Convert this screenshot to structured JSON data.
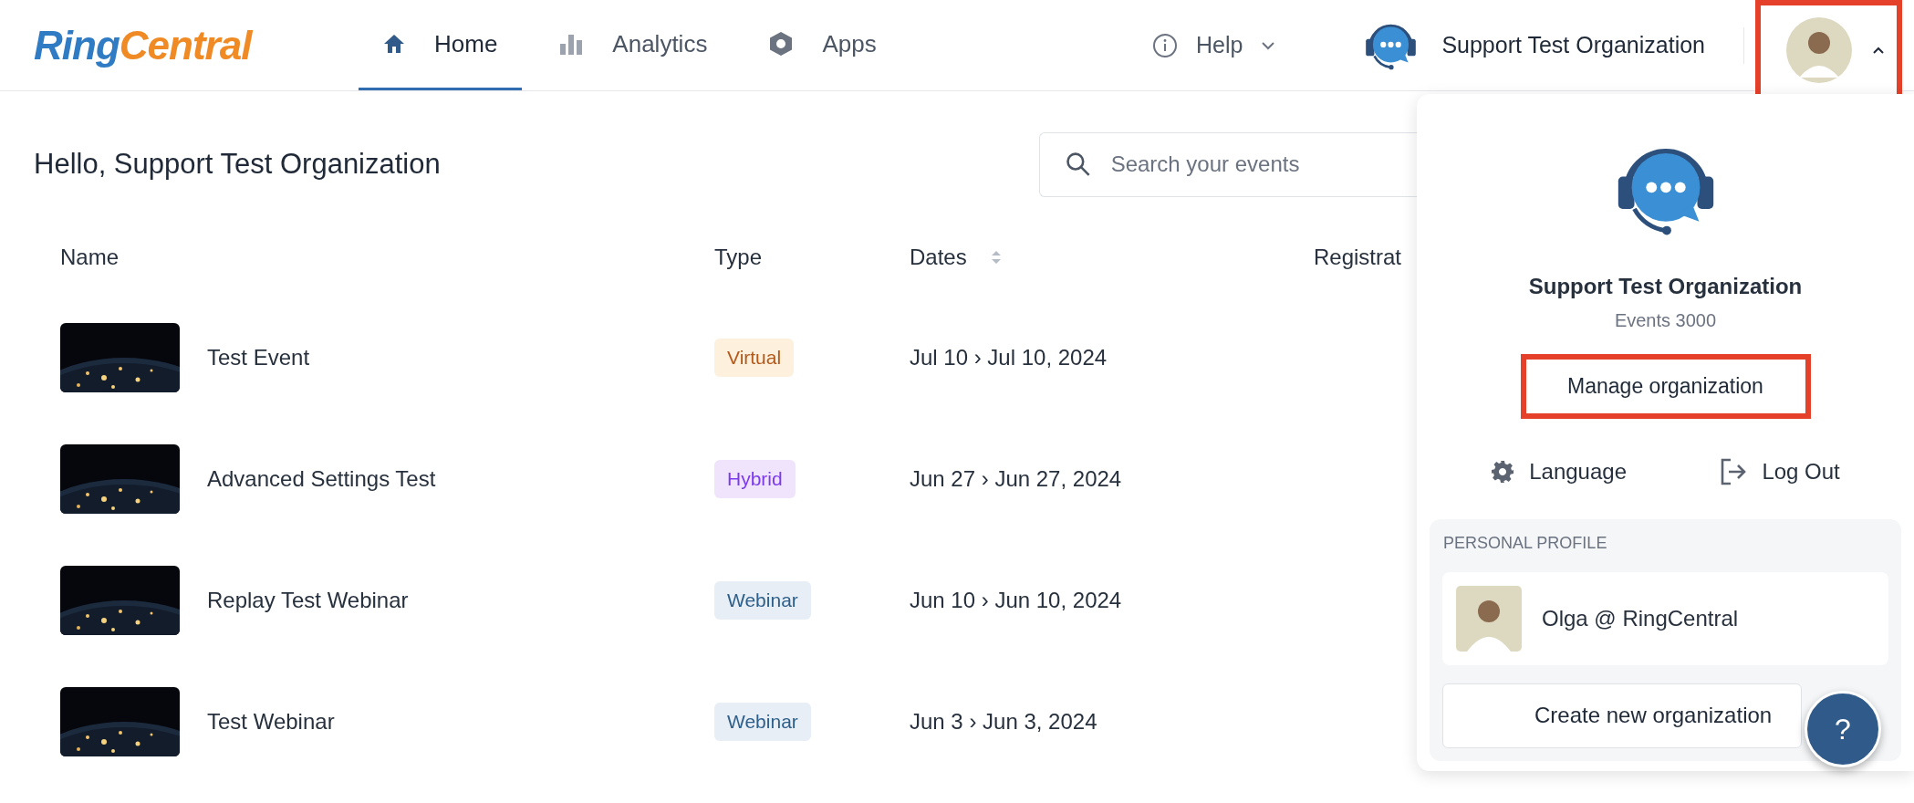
{
  "header": {
    "logo": {
      "part_1": "Ring",
      "part_2": "Central"
    },
    "nav": [
      {
        "label": "Home",
        "kind": "home",
        "selected": true
      },
      {
        "label": "Analytics",
        "kind": "analytics",
        "selected": false
      },
      {
        "label": "Apps",
        "kind": "apps",
        "selected": false
      }
    ],
    "help": "Help",
    "organization": "Support Test Organization",
    "account_menu": {
      "expanded": true,
      "highlighted": true
    }
  },
  "greeting": "Hello, Support Test Organization",
  "search": {
    "placeholder": "Search your events"
  },
  "table": {
    "columns": [
      {
        "label": "Name",
        "sortable": false
      },
      {
        "label": "Type",
        "sortable": false
      },
      {
        "label": "Dates",
        "sortable": true
      },
      {
        "label": "Registrat",
        "sortable": false
      }
    ],
    "rows": [
      {
        "name": "Test Event",
        "type": {
          "kind": "virtual",
          "label": "Virtual"
        },
        "dates": "Jul 10 › Jul 10, 2024"
      },
      {
        "name": "Advanced Settings Test",
        "type": {
          "kind": "hybrid",
          "label": "Hybrid"
        },
        "dates": "Jun 27 › Jun 27, 2024"
      },
      {
        "name": "Replay Test Webinar",
        "type": {
          "kind": "webinar",
          "label": "Webinar"
        },
        "dates": "Jun 10 › Jun 10, 2024"
      },
      {
        "name": "Test Webinar",
        "type": {
          "kind": "webinar",
          "label": "Webinar"
        },
        "dates": "Jun 3 › Jun 3, 2024"
      }
    ]
  },
  "account_panel": {
    "org_name": "Support Test Organization",
    "events": "Events 3000",
    "manage": {
      "label": "Manage organization",
      "highlighted": true
    },
    "actions": [
      {
        "kind": "language",
        "label": "Language"
      },
      {
        "kind": "logout",
        "label": "Log Out"
      }
    ],
    "profile_section": {
      "title": "PERSONAL PROFILE",
      "name": "Olga @ RingCentral"
    },
    "create": "Create new organization"
  },
  "help_fab": "?"
}
